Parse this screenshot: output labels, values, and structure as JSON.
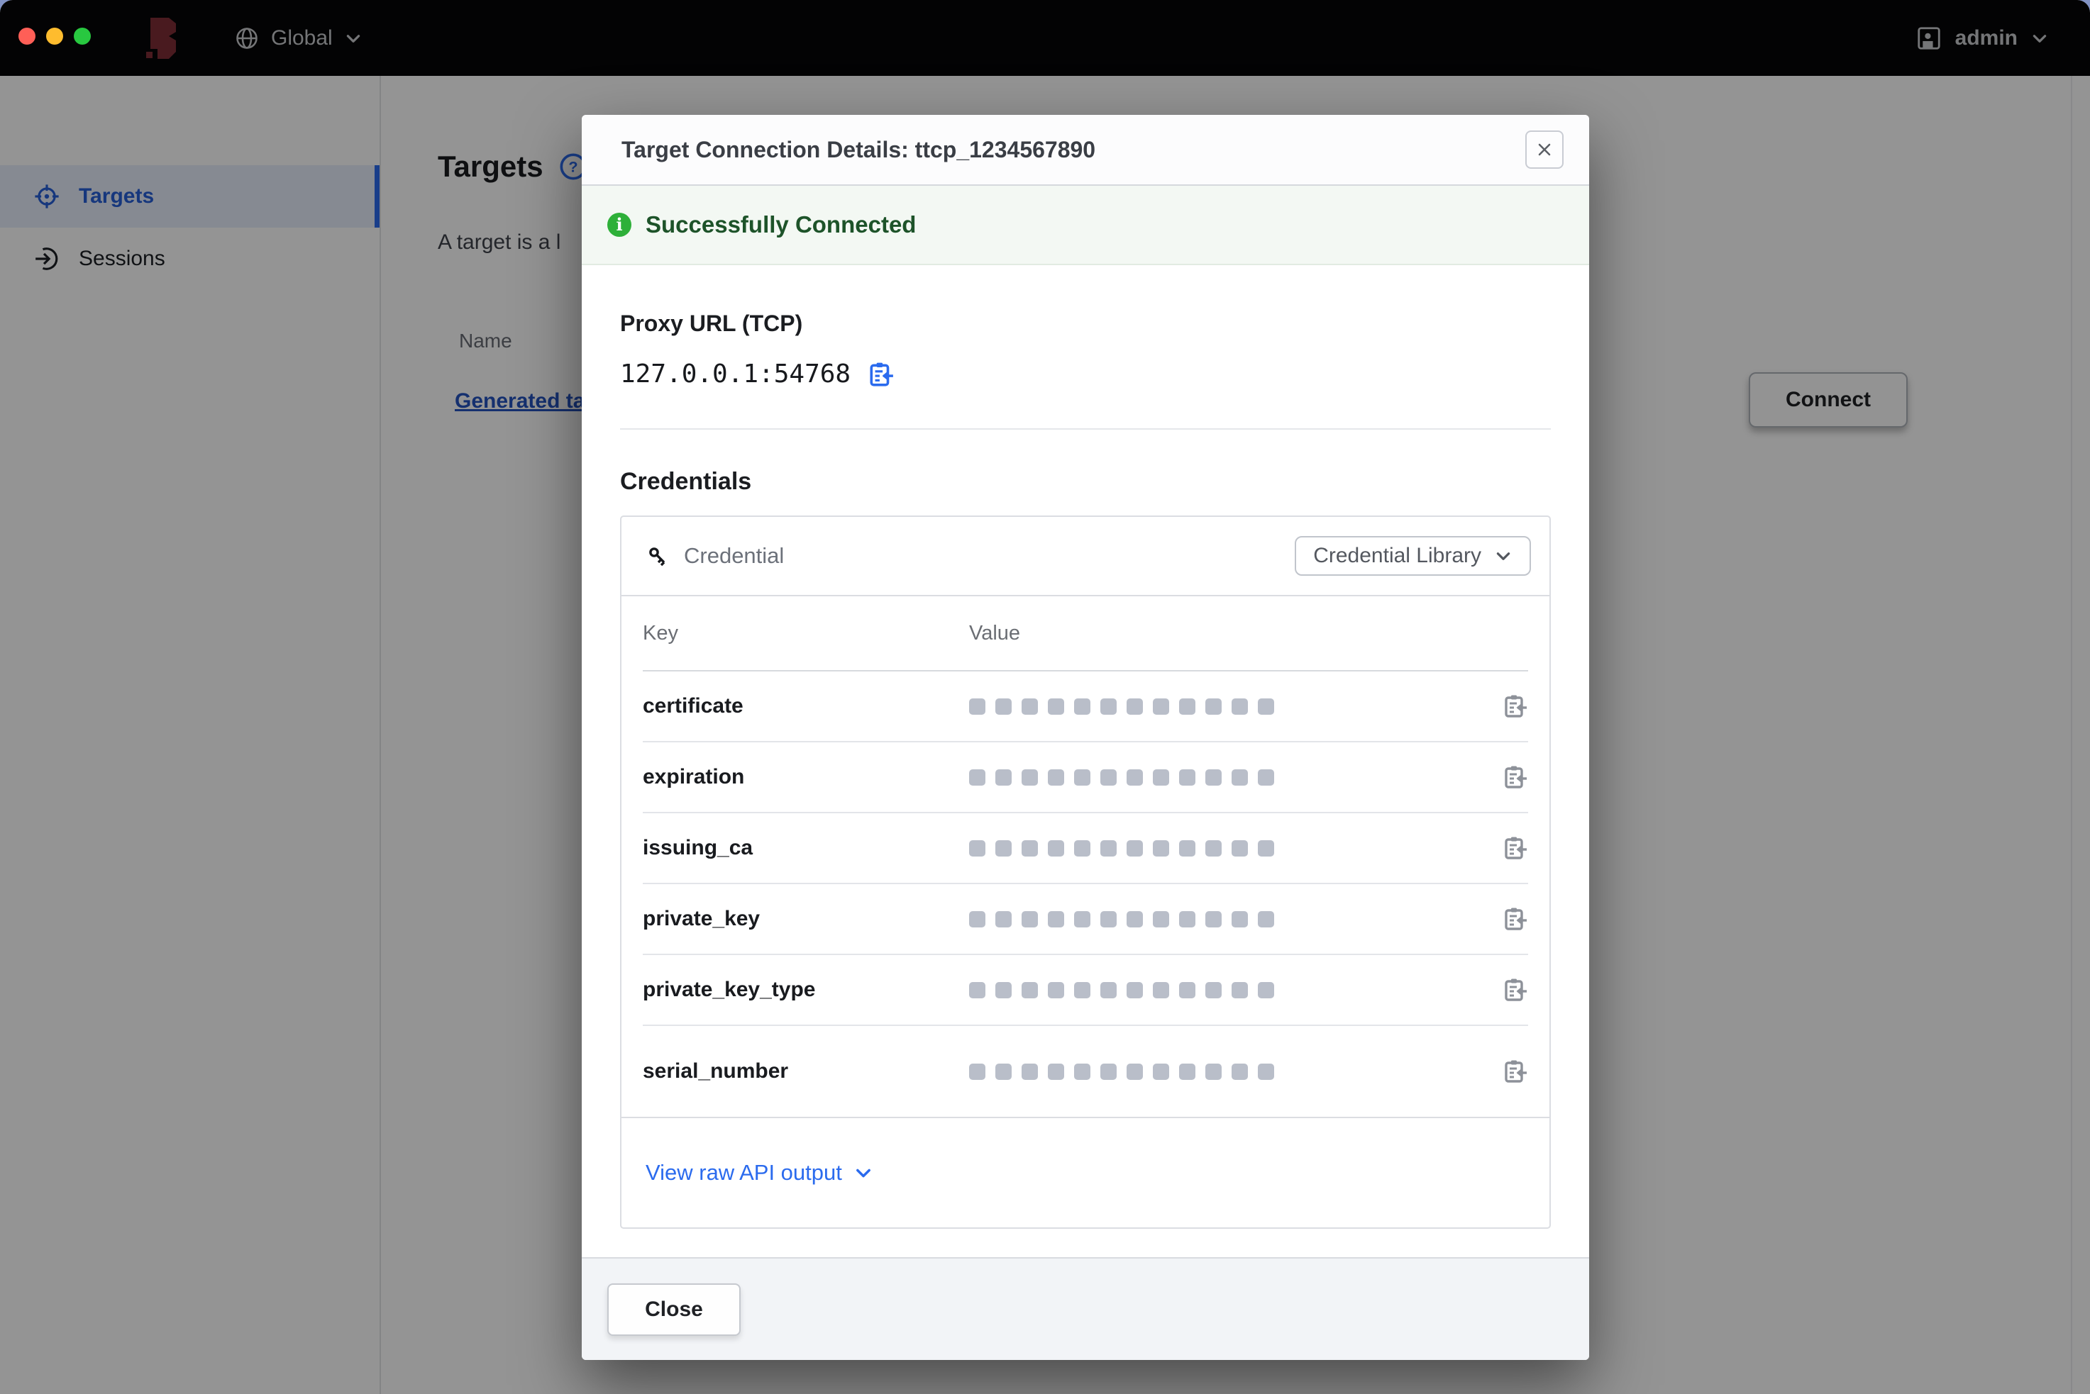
{
  "topbar": {
    "scope": {
      "label": "Global",
      "icon": "globe-icon"
    },
    "user": {
      "label": "admin",
      "icon": "user-icon"
    }
  },
  "sidebar": {
    "items": [
      {
        "label": "Targets",
        "icon": "target-icon",
        "active": true
      },
      {
        "label": "Sessions",
        "icon": "session-arrow-icon",
        "active": false
      }
    ]
  },
  "page": {
    "title": "Targets",
    "help_icon": "help-icon",
    "subtitle_visible": "A target is a l",
    "name_header": "Name",
    "row_link_visible": "Generated ta",
    "connect_button": "Connect"
  },
  "modal": {
    "title": "Target Connection Details: ttcp_1234567890",
    "close_icon": "close-x-icon",
    "banner": {
      "icon": "info-icon",
      "text": "Successfully Connected"
    },
    "proxy": {
      "label": "Proxy URL (TCP)",
      "value": "127.0.0.1:54768",
      "copy_icon": "clipboard-copy-icon"
    },
    "credentials": {
      "heading": "Credentials",
      "source_label": "Credential",
      "source_icon": "key-icon",
      "library_button": "Credential Library",
      "table": {
        "key_header": "Key",
        "value_header": "Value",
        "mask_blocks": 12,
        "rows": [
          {
            "key": "certificate",
            "masked": true
          },
          {
            "key": "expiration",
            "masked": true
          },
          {
            "key": "issuing_ca",
            "masked": true
          },
          {
            "key": "private_key",
            "masked": true
          },
          {
            "key": "private_key_type",
            "masked": true
          },
          {
            "key": "serial_number",
            "masked": true
          }
        ]
      },
      "raw_output_link": "View raw API output"
    },
    "footer": {
      "close_button": "Close"
    }
  },
  "colors": {
    "accent_blue": "#2b6bee",
    "success_green": "#2eb039",
    "success_text": "#1d5329",
    "banner_bg": "#f3f8f3",
    "mask_gray": "#b9bec9",
    "topbar_bg": "#060607",
    "brand_red": "#7e2d36",
    "overlay": "rgba(0,0,0,0.42)"
  }
}
